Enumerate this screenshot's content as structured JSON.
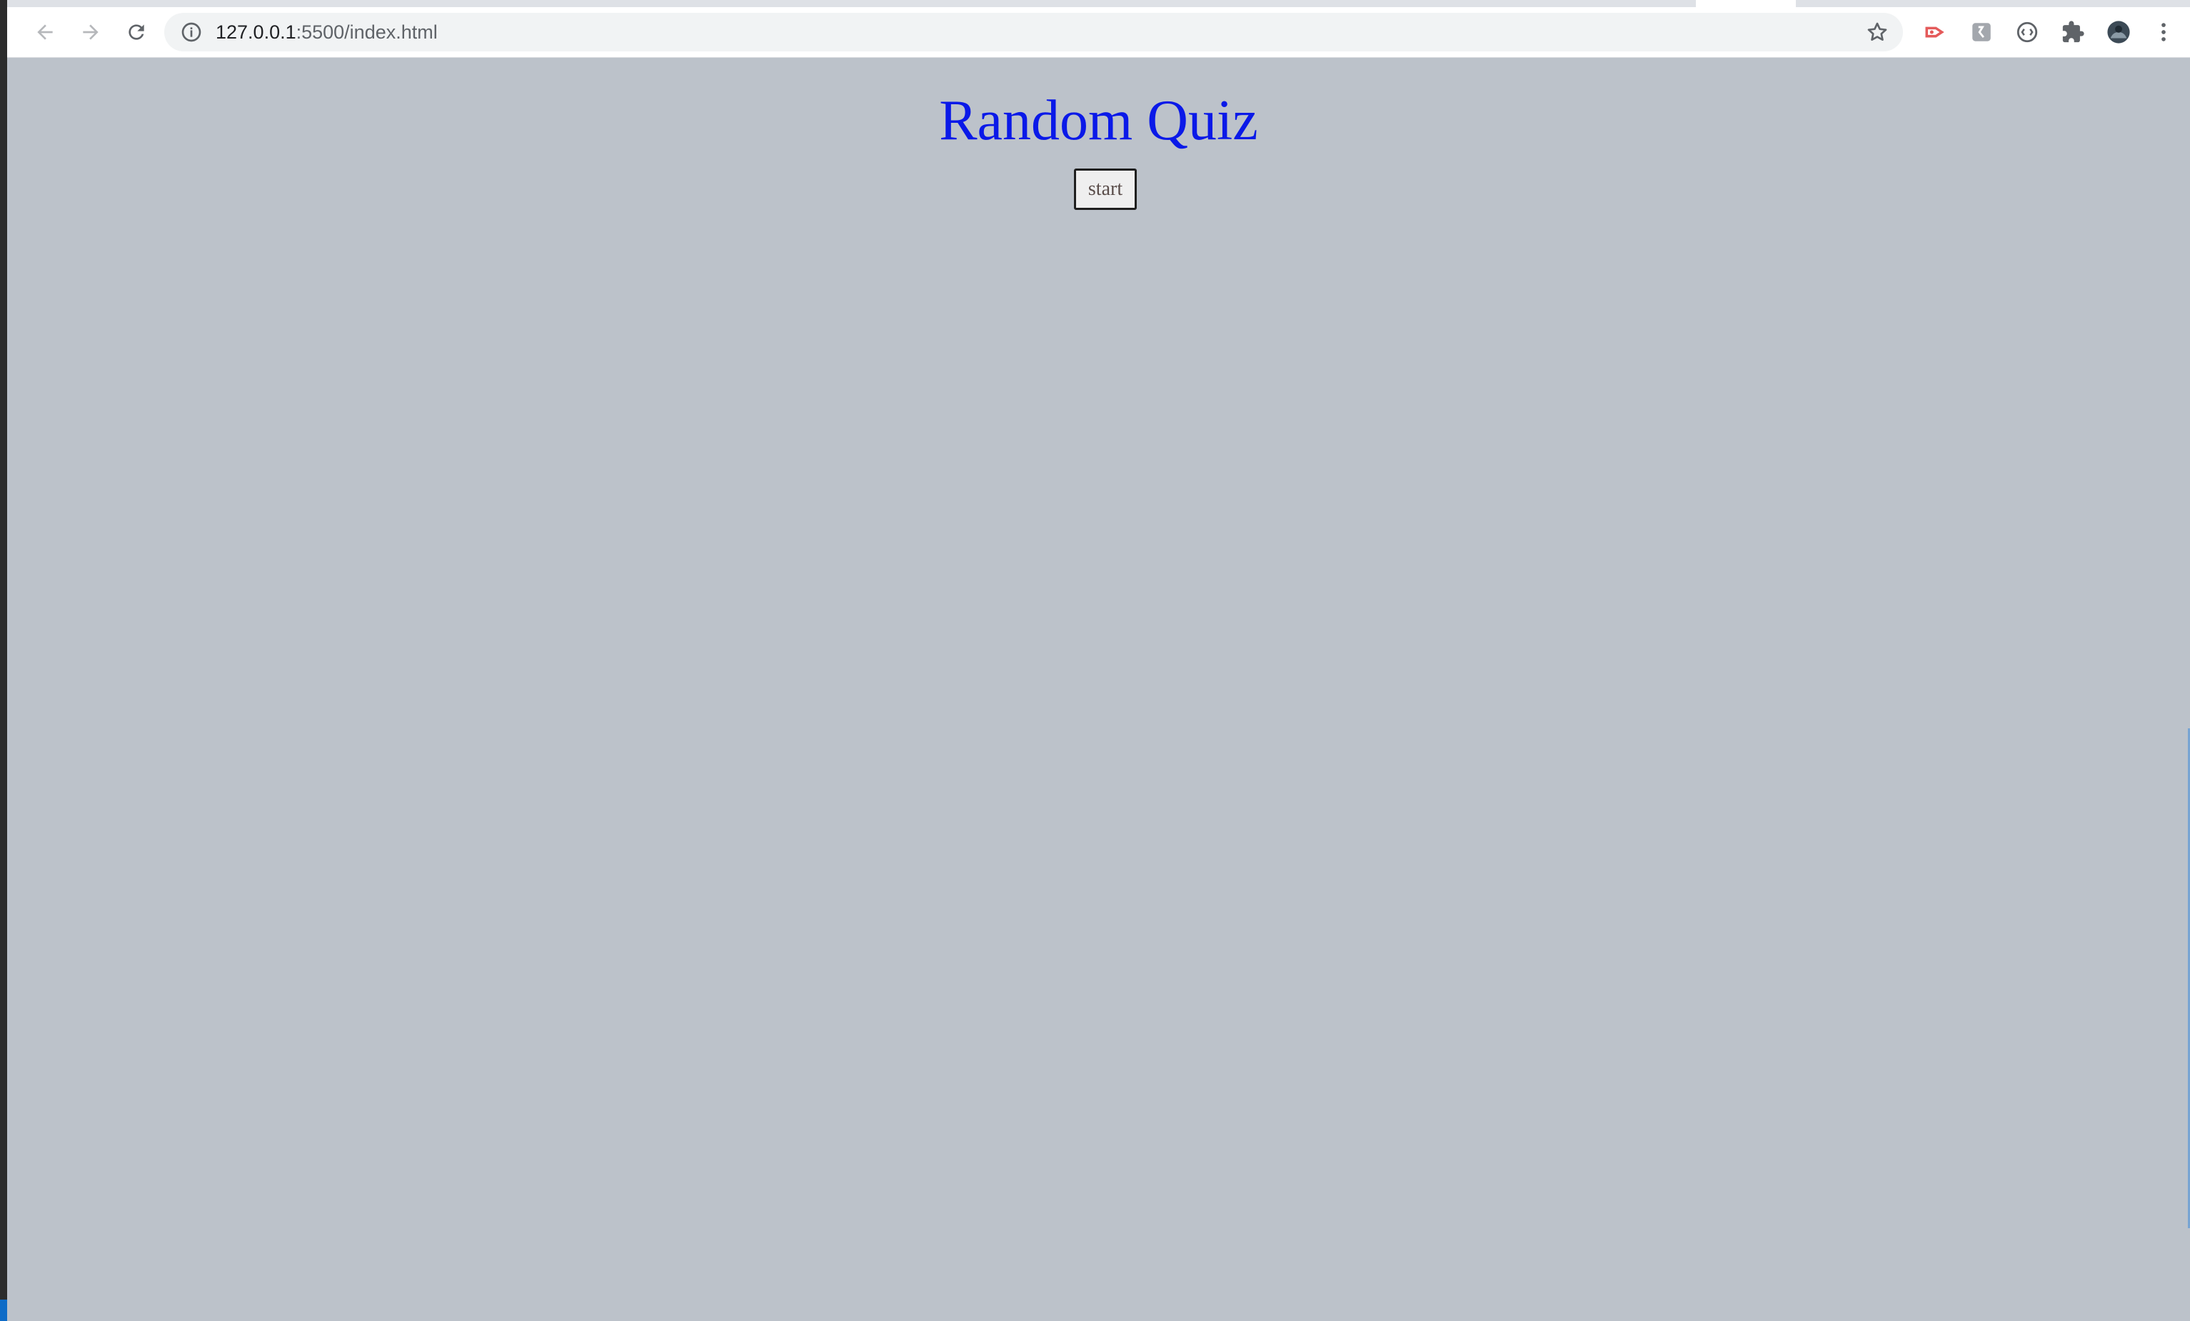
{
  "browser": {
    "url_host": "127.0.0.1",
    "url_path": ":5500/index.html",
    "icons": {
      "back": "back-arrow-icon",
      "forward": "forward-arrow-icon",
      "reload": "reload-icon",
      "site_info": "info-icon",
      "bookmark": "star-icon",
      "extensions": [
        "recorder-extension-icon",
        "translate-extension-icon",
        "devtools-extension-icon",
        "puzzle-icon"
      ],
      "profile": "avatar-icon",
      "menu": "kebab-menu-icon"
    }
  },
  "page": {
    "title": "Random Quiz",
    "start_label": "start",
    "colors": {
      "background": "#bcc2ca",
      "title": "#0a19e8"
    }
  }
}
